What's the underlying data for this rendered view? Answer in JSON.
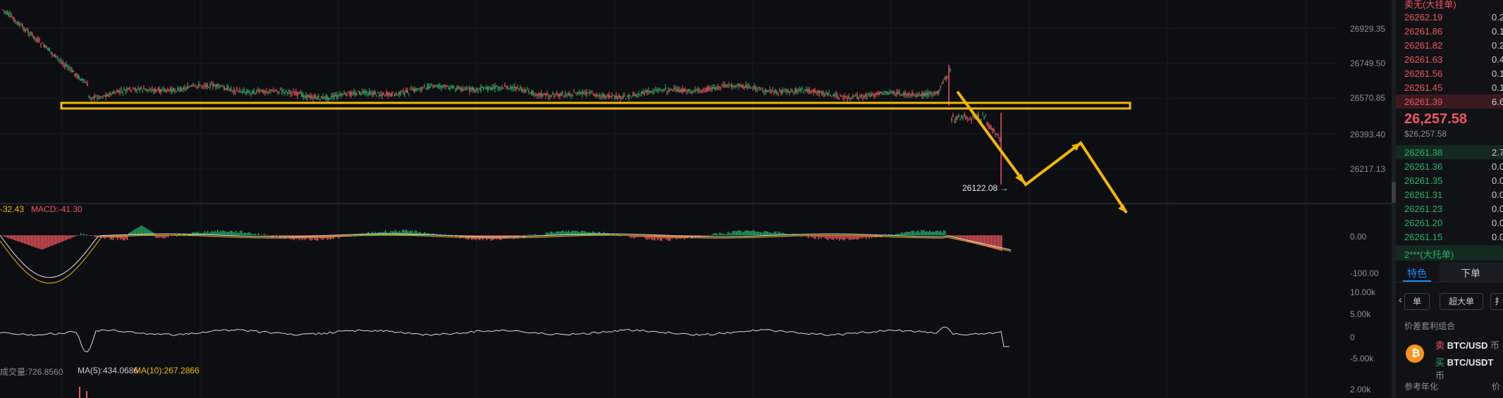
{
  "price_axis": {
    "labels": [
      "26929.35",
      "26749.50",
      "26570.85",
      "26393.40",
      "26217.13"
    ],
    "last_low_marker": "26122.08 →"
  },
  "macd": {
    "legend_dif": "-32.43",
    "legend_macd": "MACD:-41.30",
    "axis_labels": [
      "0.00",
      "-100.00"
    ]
  },
  "volume_line": {
    "axis_labels": [
      "10.00k",
      "5.00k",
      "0",
      "-5.00k"
    ]
  },
  "volume": {
    "legend_prefix": "成交量:726.8560",
    "ma5": "MA(5):434.0686",
    "ma10": "MA(10):267.2866",
    "axis_label": "2.00k"
  },
  "orderbook": {
    "header_asks": "卖无(大挂单)",
    "asks": [
      {
        "price": "26262.19",
        "qty": "0.2"
      },
      {
        "price": "26261.86",
        "qty": "0.1"
      },
      {
        "price": "26261.82",
        "qty": "0.2"
      },
      {
        "price": "26261.63",
        "qty": "0.4"
      },
      {
        "price": "26261.56",
        "qty": "0.1"
      },
      {
        "price": "26261.45",
        "qty": "0.1"
      },
      {
        "price": "26261.39",
        "qty": "6.6"
      }
    ],
    "last_price": "26,257.58",
    "last_price_usd": "$26,257.58",
    "bids": [
      {
        "price": "26261.38",
        "qty": "2.7"
      },
      {
        "price": "26261.36",
        "qty": "0.0"
      },
      {
        "price": "26261.35",
        "qty": "0.0"
      },
      {
        "price": "26261.31",
        "qty": "0.0"
      },
      {
        "price": "26261.23",
        "qty": "0.0"
      },
      {
        "price": "26261.20",
        "qty": "0.0"
      },
      {
        "price": "26261.15",
        "qty": "0.0"
      }
    ],
    "header_bids": "2***(大托单)"
  },
  "side_tabs": {
    "tab1": "特色",
    "tab2": "下单"
  },
  "filters": {
    "chip1": "单",
    "chip2": "超大单",
    "chip3": "扌"
  },
  "arbitrage": {
    "title": "价差套利组合",
    "row1_side": "卖",
    "row1_pair": "BTC/USD",
    "row1_suffix": "币",
    "row2_side": "买",
    "row2_pair": "BTC/USDT",
    "row2_suffix": "币"
  },
  "footer": {
    "left": "参考年化",
    "right": "价"
  },
  "colors": {
    "up": "#26b36b",
    "down": "#f0555e",
    "annotation": "#f5b800",
    "accent": "#1e88ff"
  }
}
